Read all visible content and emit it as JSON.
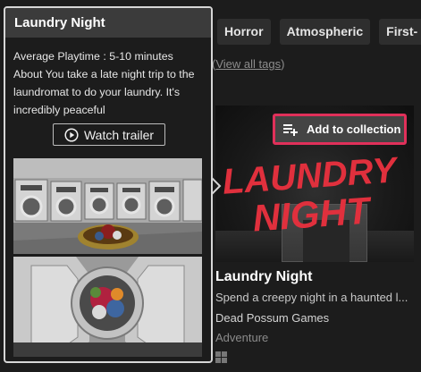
{
  "tags": [
    "Horror",
    "Atmospheric",
    "First-"
  ],
  "view_all_tags": "View all tags",
  "popup": {
    "title": "Laundry Night",
    "playtime": "Average Playtime : 5-10 minutes",
    "about": "About You take a late night trip to the laundromat to do your laundry. It's incredibly peaceful",
    "trailer_button": "Watch trailer",
    "screenshots": [
      "laundromat-washers",
      "washing-machine-porthole"
    ]
  },
  "game": {
    "cover_logo_line1": "LAUNDRY",
    "cover_logo_line2": "NIGHT",
    "add_collection": "Add to collection",
    "title": "Laundry Night",
    "description": "Spend a creepy night in a haunted l...",
    "developer": "Dead Possum Games",
    "genre": "Adventure",
    "platform_icon": "windows-icon"
  },
  "colors": {
    "accent": "#e0305a",
    "logo_red": "#e0303d"
  }
}
